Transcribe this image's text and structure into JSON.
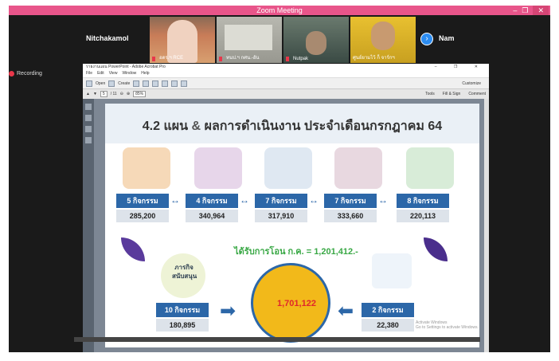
{
  "zoom": {
    "window_title": "Zoom Meeting",
    "recording_label": "Recording",
    "participants": [
      {
        "name": "Nitchakamol",
        "label": "",
        "type": "name-only"
      },
      {
        "name": "",
        "label": "อดร.ฯ RCE",
        "type": "video"
      },
      {
        "name": "",
        "label": "ทนป.ฯ กศน.-อัน",
        "type": "video"
      },
      {
        "name": "",
        "label": "Nutpak",
        "type": "video"
      },
      {
        "name": "",
        "label": "ศูนย์ยามไว้ ก็ จาร์กฯ",
        "type": "video"
      },
      {
        "name": "Nam",
        "label": "",
        "type": "name-only"
      }
    ]
  },
  "acrobat": {
    "title": "รายงานแผน PowerPoint - Adobe Acrobat Pro",
    "menu": [
      "File",
      "Edit",
      "View",
      "Window",
      "Help"
    ],
    "toolbar": {
      "open": "Open",
      "create": "Create",
      "customize": "Customize"
    },
    "nav": {
      "page": "5",
      "page_count": "/ 11",
      "zoom": "85%",
      "tools": "Tools",
      "fill_sign": "Fill & Sign",
      "comment": "Comment"
    }
  },
  "slide": {
    "title_prefix": "4.2 แผน",
    "title_amp": "&",
    "title_rest": "ผลการดำเนินงาน ประจำเดือนกรกฎาคม 64",
    "activities": [
      {
        "label": "5 กิจกรรม",
        "value": "285,200"
      },
      {
        "label": "4 กิจกรรม",
        "value": "340,964"
      },
      {
        "label": "7 กิจกรรม",
        "value": "317,910"
      },
      {
        "label": "7 กิจกรรม",
        "value": "333,660"
      },
      {
        "label": "8 กิจกรรม",
        "value": "220,113"
      }
    ],
    "transfer_text": "ได้รับการโอน ก.ค. = 1,201,412.-",
    "mission_text_1": "ภารกิจ",
    "mission_text_2": "สนับสนุน",
    "left_box": {
      "label": "10 กิจกรรม",
      "value": "180,895"
    },
    "right_box": {
      "label": "2 กิจกรรม",
      "value": "22,380"
    },
    "total": "1,701,122",
    "watermark_1": "Activate Windows",
    "watermark_2": "Go to Settings to activate Windows."
  },
  "colors": {
    "zoom_titlebar": "#e8558a",
    "box_blue": "#2c67a8",
    "value_gray": "#dde3ea",
    "transfer_green": "#39a845",
    "total_red": "#e0262b",
    "coin_yellow": "#f2b91a"
  }
}
